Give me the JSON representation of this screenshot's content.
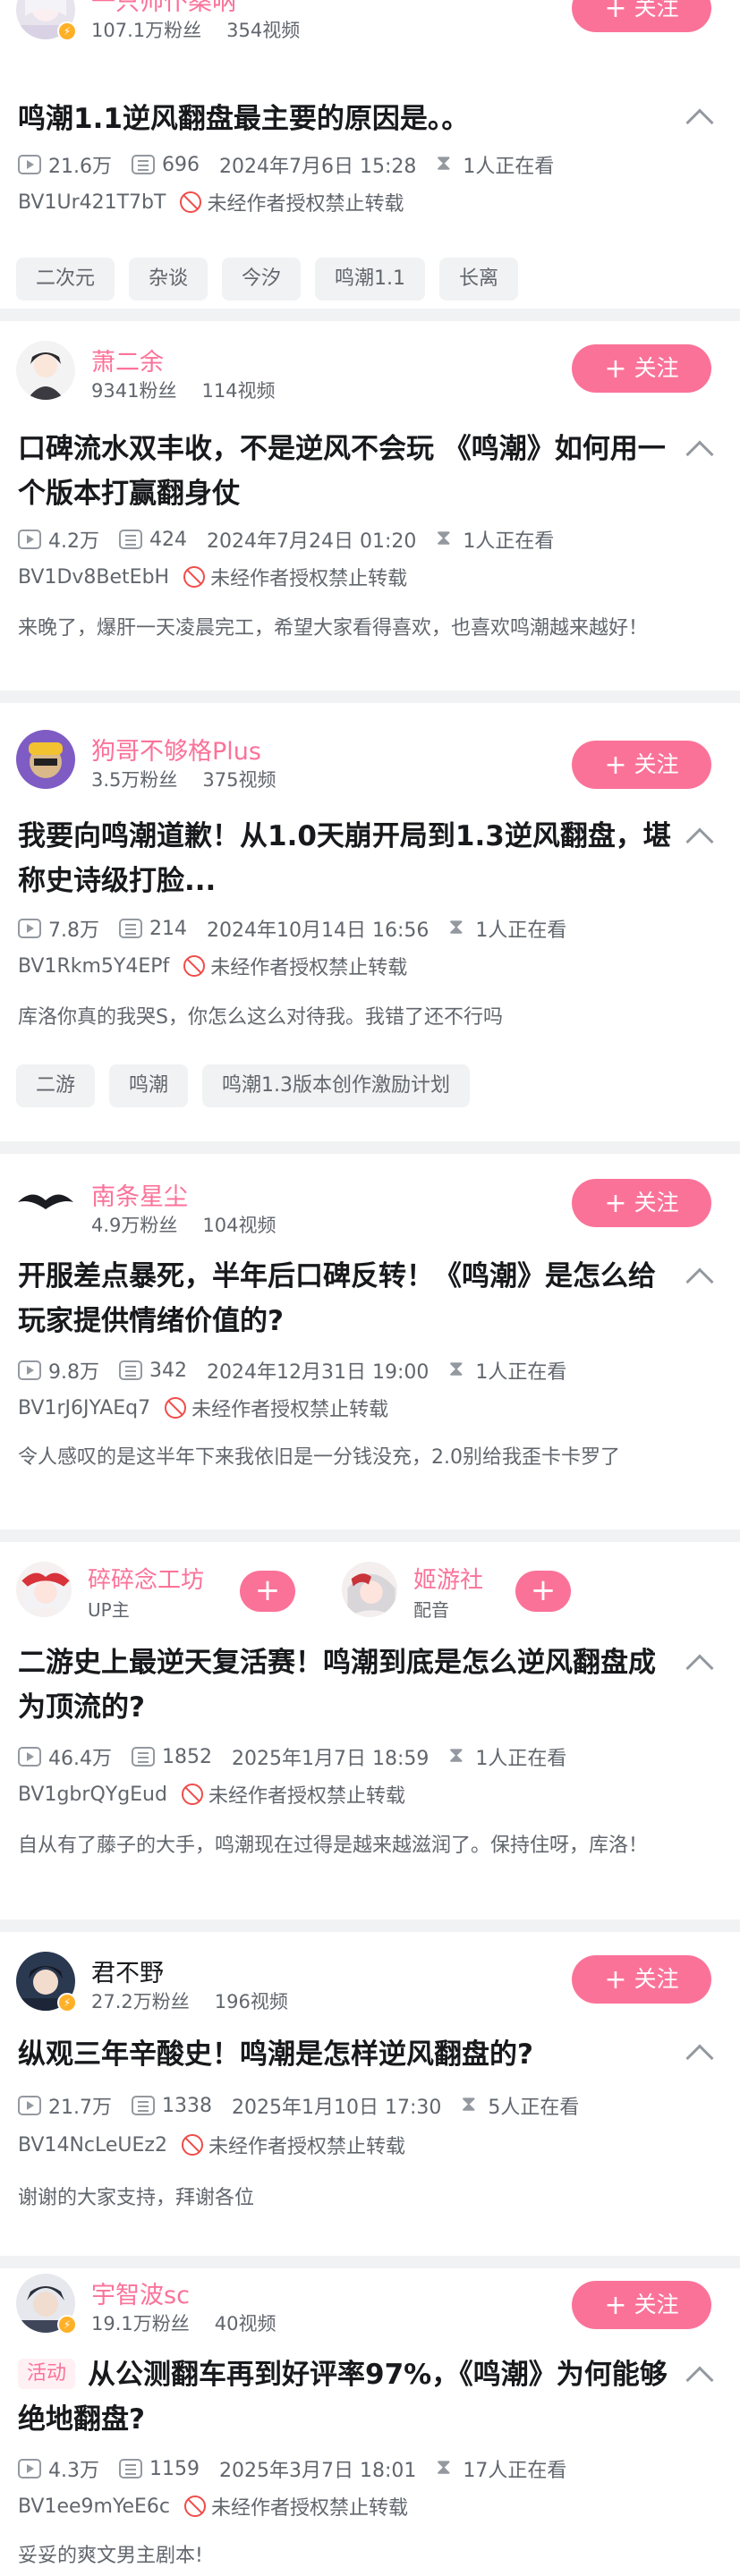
{
  "follow_label": "关注",
  "plus_glyph": "+",
  "ban_text": "未经作者授权禁止转载",
  "accent_color": "#fb7299",
  "posts": [
    {
      "uploader": "一只帅仆桑呐",
      "fans": "107.1万粉丝",
      "videos": "354视频",
      "title": "鸣潮1.1逆风翻盘最主要的原因是。。",
      "plays": "21.6万",
      "danmaku": "696",
      "date": "2024年7月6日 15:28",
      "watching": "1人正在看",
      "bvid": "BV1Ur421T7bT",
      "desc": "",
      "tags": [
        "二次元",
        "杂谈",
        "今汐",
        "鸣潮1.1",
        "长离"
      ]
    },
    {
      "uploader": "萧二余",
      "fans": "9341粉丝",
      "videos": "114视频",
      "title": "口碑流水双丰收，不是逆风不会玩 《鸣潮》如何用一个版本打赢翻身仗",
      "plays": "4.2万",
      "danmaku": "424",
      "date": "2024年7月24日 01:20",
      "watching": "1人正在看",
      "bvid": "BV1Dv8BetEbH",
      "desc": "来晚了，爆肝一天凌晨完工，希望大家看得喜欢，也喜欢鸣潮越来越好！",
      "tags": []
    },
    {
      "uploader": "狗哥不够格Plus",
      "fans": "3.5万粉丝",
      "videos": "375视频",
      "title": "我要向鸣潮道歉！从1.0天崩开局到1.3逆风翻盘，堪称史诗级打脸...",
      "plays": "7.8万",
      "danmaku": "214",
      "date": "2024年10月14日 16:56",
      "watching": "1人正在看",
      "bvid": "BV1Rkm5Y4EPf",
      "desc": "库洛你真的我哭S，你怎么这么对待我。我错了还不行吗",
      "tags": [
        "二游",
        "鸣潮",
        "鸣潮1.3版本创作激励计划"
      ]
    },
    {
      "uploader": "南条星尘",
      "fans": "4.9万粉丝",
      "videos": "104视频",
      "title": "开服差点暴死，半年后口碑反转！《鸣潮》是怎么给玩家提供情绪价值的?",
      "plays": "9.8万",
      "danmaku": "342",
      "date": "2024年12月31日 19:00",
      "watching": "1人正在看",
      "bvid": "BV1rJ6JYAEq7",
      "desc": "令人感叹的是这半年下来我依旧是一分钱没充，2.0别给我歪卡卡罗了",
      "tags": []
    },
    {
      "uploader": "碎碎念工坊",
      "uploader_role": "UP主",
      "co_uploader": "姬游社",
      "co_role": "配音",
      "title": "二游史上最逆天复活赛！鸣潮到底是怎么逆风翻盘成为顶流的?",
      "plays": "46.4万",
      "danmaku": "1852",
      "date": "2025年1月7日 18:59",
      "watching": "1人正在看",
      "bvid": "BV1gbrQYgEud",
      "desc": "自从有了藤子的大手，鸣潮现在过得是越来越滋润了。保持住呀，库洛！",
      "tags": []
    },
    {
      "uploader": "君不野",
      "fans": "27.2万粉丝",
      "videos": "196视频",
      "title": "纵观三年辛酸史！鸣潮是怎样逆风翻盘的?",
      "plays": "21.7万",
      "danmaku": "1338",
      "date": "2025年1月10日 17:30",
      "watching": "5人正在看",
      "bvid": "BV14NcLeUEz2",
      "desc": "谢谢的大家支持，拜谢各位",
      "tags": []
    },
    {
      "uploader": "宇智波sc",
      "fans": "19.1万粉丝",
      "videos": "40视频",
      "title_tag": "活动",
      "title": "从公测翻车再到好评率97%，《鸣潮》为何能够绝地翻盘?",
      "plays": "4.3万",
      "danmaku": "1159",
      "date": "2025年3月7日 18:01",
      "watching": "17人正在看",
      "bvid": "BV1ee9mYeE6c",
      "desc": "妥妥的爽文男主剧本!",
      "tags": []
    }
  ]
}
